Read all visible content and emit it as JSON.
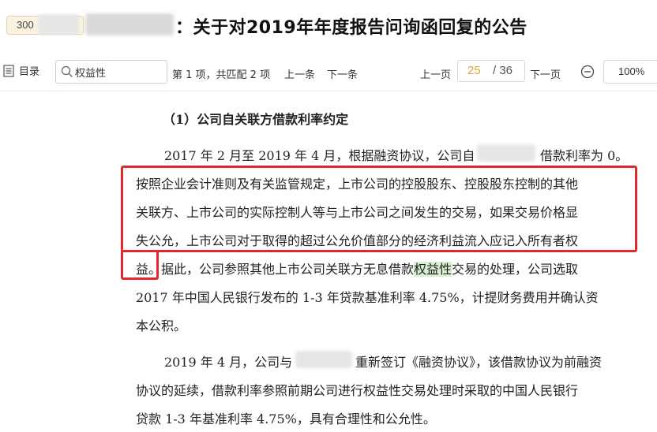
{
  "header": {
    "stock_code": "300",
    "title": "：关于对2019年年度报告问询函回复的公告"
  },
  "toolbar": {
    "toc_label": "目录",
    "search_value": "权益性",
    "match_info": "第 1 项，共匹配 2 项",
    "prev_match": "上一条",
    "next_match": "下一条",
    "prev_page": "上一页",
    "page_current": "25",
    "page_total": "/ 36",
    "next_page": "下一页",
    "zoom": "100%"
  },
  "document": {
    "heading": "（1）公司自关联方借款利率约定",
    "p1_a": "2017 年 2 月至 2019 年 4 月，根据融资协议，公司自",
    "p1_b": "借款利率为 0。",
    "p1_l2": "按照企业会计准则及有关监管规定，上市公司的控股股东、控股股东控制的其他",
    "p1_l3": "关联方、上市公司的实际控制人等与上市公司之间发生的交易，如果交易价格显",
    "p1_l4": "失公允，上市公司对于取得的超过公允价值部分的经济利益流入应记入所有者权",
    "p1_l5_boxed": "益。",
    "p1_l5_a": "据此，公司参照其他上市公司关联方无息借款",
    "p1_l5_hl": "权益性",
    "p1_l5_b": "交易的处理，公司选取",
    "p1_l6": "2017 年中国人民银行发布的 1-3 年贷款基准利率 4.75%，计提财务费用并确认资",
    "p1_l7": "本公积。",
    "p2_a": "2019 年 4 月，公司与",
    "p2_b": "重新签订《融资协议》，该借款协议为前融资",
    "p2_l2": "协议的延续，借款利率参照前期公司进行权益性交易处理时采取的中国人民银行",
    "p2_l3": "贷款 1-3 年基准利率 4.75%，具有合理性和公允性。"
  },
  "colors": {
    "annotation_red": "#e3262b",
    "search_highlight": "#d9efd2",
    "page_number": "#e8a33a"
  }
}
